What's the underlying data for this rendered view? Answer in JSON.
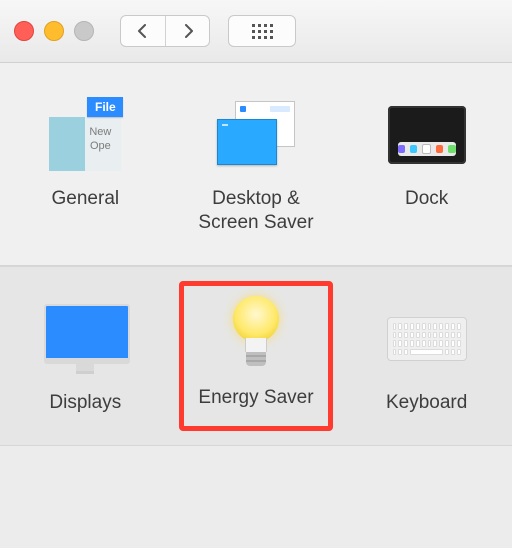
{
  "row1": {
    "general": {
      "label": "General",
      "file_badge": "File",
      "file_hint": "New\nOpe"
    },
    "desktop": {
      "label": "Desktop & Screen Saver"
    },
    "dock": {
      "label": "Dock"
    }
  },
  "row2": {
    "displays": {
      "label": "Displays"
    },
    "energy": {
      "label": "Energy Saver",
      "highlighted": true
    },
    "keyboard": {
      "label": "Keyboard"
    }
  }
}
